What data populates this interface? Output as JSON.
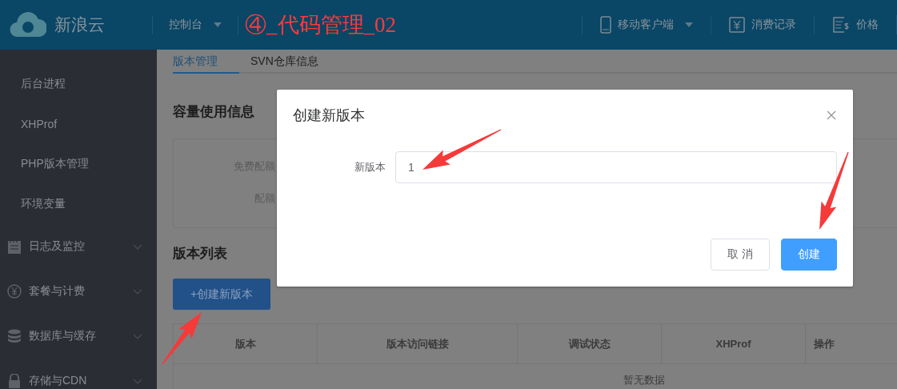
{
  "header": {
    "logo_text": "新浪云",
    "nav": [
      {
        "label": "控制台",
        "dropdown": true
      }
    ],
    "annotation": "④_代码管理_02",
    "links": [
      {
        "label": "移动客户端",
        "dropdown": true
      },
      {
        "label": "消费记录",
        "dropdown": false
      },
      {
        "label": "价格",
        "dropdown": false
      }
    ]
  },
  "sidebar": {
    "items": [
      {
        "kind": "link",
        "label": "后台进程"
      },
      {
        "kind": "link",
        "label": "XHProf"
      },
      {
        "kind": "link",
        "label": "PHP版本管理"
      },
      {
        "kind": "link",
        "label": "环境变量"
      },
      {
        "kind": "group",
        "label": "日志及监控",
        "expanded": false
      },
      {
        "kind": "group",
        "label": "套餐与计费",
        "expanded": false
      },
      {
        "kind": "group",
        "label": "数据库与缓存",
        "expanded": false
      },
      {
        "kind": "group",
        "label": "存储与CDN",
        "expanded": false
      }
    ]
  },
  "tabs": [
    {
      "label": "版本管理",
      "selected": true
    },
    {
      "label": "SVN仓库信息",
      "selected": false
    }
  ],
  "capacity": {
    "title": "容量使用信息",
    "rows": [
      {
        "label": "免费配额"
      },
      {
        "label": "配额"
      }
    ]
  },
  "versions": {
    "title": "版本列表",
    "create_button": "+创建新版本",
    "table": {
      "columns": [
        "版本",
        "版本访问链接",
        "调试状态",
        "XHProf",
        "操作"
      ],
      "empty_text": "暂无数据"
    }
  },
  "dialog": {
    "title": "创建新版本",
    "field": {
      "label": "新版本",
      "value": "1"
    },
    "buttons": [
      {
        "label": "取 消",
        "kind": "default"
      },
      {
        "label": "创建",
        "kind": "primary"
      }
    ]
  }
}
